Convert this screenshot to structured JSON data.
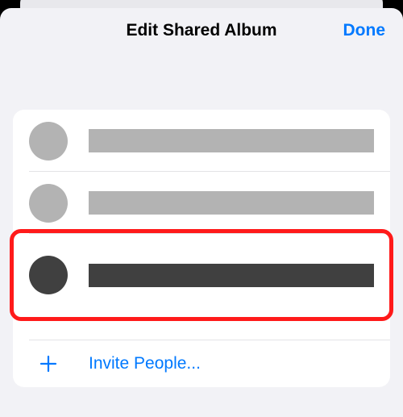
{
  "header": {
    "title": "Edit Shared Album",
    "done_label": "Done"
  },
  "invite": {
    "label": "Invite People..."
  },
  "colors": {
    "accent": "#0079ff",
    "highlight": "#ff1a1a"
  }
}
